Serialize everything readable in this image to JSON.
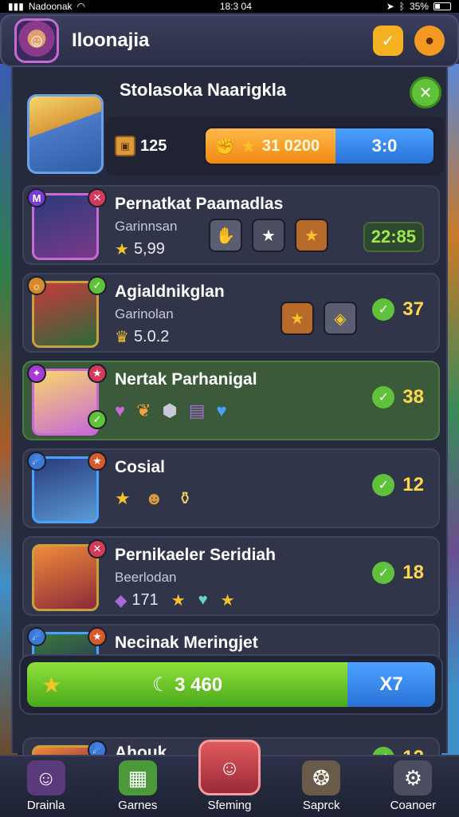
{
  "status_bar": {
    "carrier": "Nadoonak",
    "time": "18:3 04",
    "battery": "35%"
  },
  "header": {
    "title": "Iloonajia"
  },
  "featured": {
    "title": "Stolasoka Naarigkla",
    "count": "125",
    "progress_label": "31 0200",
    "progress_fraction": 0.57,
    "progress_right": "3:0"
  },
  "cards": [
    {
      "name": "Pernatkat Paamadlas",
      "subtitle": "Garinnsan",
      "stat": "5,99",
      "timer": "22:85"
    },
    {
      "name": "Agialdnikglan",
      "subtitle": "Garinolan",
      "stat": "5.0.2",
      "score": "37"
    },
    {
      "name": "Nertak Parhanigal",
      "score": "38"
    },
    {
      "name": "Cosial",
      "score": "12"
    },
    {
      "name": "Pernikaeler Seridiah",
      "subtitle": "Beerlodan",
      "stat": "171",
      "score": "18"
    },
    {
      "name": "Necinak Meringjet"
    },
    {
      "name": "Ahouk",
      "score": "12"
    }
  ],
  "action_bar": {
    "label": "3 460",
    "right": "X7"
  },
  "nav": [
    {
      "label": "Drainla"
    },
    {
      "label": "Garnes"
    },
    {
      "label": "Sfeming"
    },
    {
      "label": "Saprck"
    },
    {
      "label": "Coanoer"
    }
  ]
}
